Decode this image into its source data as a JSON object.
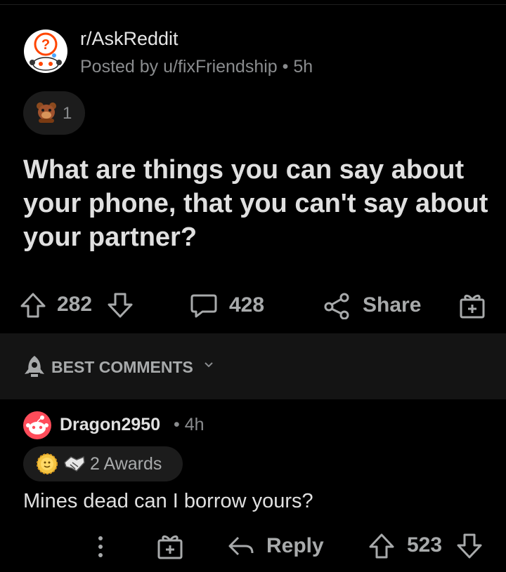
{
  "post": {
    "subreddit": "r/AskReddit",
    "posted_by": "Posted by u/fixFriendship • 5h",
    "award_count": "1",
    "title": "What are things you can say about your phone, that you can't say about your partner?",
    "upvotes": "282",
    "comments": "428",
    "share_label": "Share"
  },
  "sort": {
    "label": "BEST COMMENTS"
  },
  "comment": {
    "username": "Dragon2950",
    "time": "• 4h",
    "awards_label": "2 Awards",
    "body": "Mines dead can I borrow yours?",
    "reply_label": "Reply",
    "score": "523"
  },
  "colors": {
    "background": "#000000",
    "text_primary": "#e0e0e0",
    "text_muted": "#8a8c8e",
    "icon_gray": "#a8aaab",
    "sortbar_bg": "#141414",
    "pill_bg": "#1c1c1c",
    "reddit_red": "#ff4500"
  },
  "icons": {
    "subreddit_avatar": "askreddit-snoo-icon",
    "post_award": "bear-award-icon",
    "upvote": "arrow-up-icon",
    "downvote": "arrow-down-icon",
    "comments": "speech-bubble-icon",
    "share": "share-nodes-icon",
    "gift": "gift-award-icon",
    "sort": "rocket-icon",
    "more": "vertical-dots-icon",
    "reply": "reply-arrow-icon"
  }
}
